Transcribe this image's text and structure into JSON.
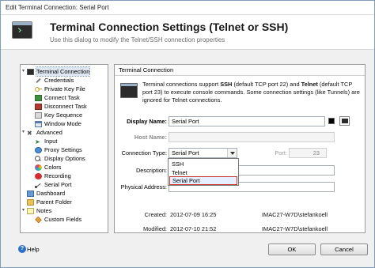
{
  "window": {
    "title": "Edit Terminal Connection: Serial Port"
  },
  "header": {
    "title": "Terminal Connection Settings (Telnet or SSH)",
    "subtitle": "Use this dialog to modify the Telnet/SSH connection properties"
  },
  "tree": {
    "items": [
      {
        "label": "Terminal Connection",
        "icon": "terminal-icon",
        "level": 0,
        "expanded": true,
        "selected": true
      },
      {
        "label": "Credentials",
        "icon": "wrench-icon",
        "level": 1
      },
      {
        "label": "Private Key File",
        "icon": "key-icon",
        "level": 1
      },
      {
        "label": "Connect Task",
        "icon": "connect-task-icon",
        "level": 1
      },
      {
        "label": "Disconnect Task",
        "icon": "disconnect-task-icon",
        "level": 1
      },
      {
        "label": "Key Sequence",
        "icon": "key-sequence-icon",
        "level": 1
      },
      {
        "label": "Window Mode",
        "icon": "window-icon",
        "level": 1
      },
      {
        "label": "Advanced",
        "icon": "tools-icon",
        "level": 0,
        "expanded": true
      },
      {
        "label": "Input",
        "icon": "input-icon",
        "level": 1
      },
      {
        "label": "Proxy Settings",
        "icon": "globe-icon",
        "level": 1
      },
      {
        "label": "Display Options",
        "icon": "search-icon",
        "level": 1
      },
      {
        "label": "Colors",
        "icon": "colors-icon",
        "level": 1
      },
      {
        "label": "Recording",
        "icon": "record-icon",
        "level": 1
      },
      {
        "label": "Serial Port",
        "icon": "serial-port-icon",
        "level": 1
      },
      {
        "label": "Dashboard",
        "icon": "dashboard-icon",
        "level": 0
      },
      {
        "label": "Parent Folder",
        "icon": "folder-icon",
        "level": 0
      },
      {
        "label": "Notes",
        "icon": "notes-icon",
        "level": 0,
        "expanded": true
      },
      {
        "label": "Custom Fields",
        "icon": "custom-fields-icon",
        "level": 1
      }
    ]
  },
  "panel": {
    "title": "Terminal Connection",
    "desc_pre": "Terminal connections support ",
    "desc_ssh": "SSH",
    "desc_mid": " (default TCP port 22) and ",
    "desc_telnet": "Telnet",
    "desc_post": " (default TCP port 23) to execute console commands. Some connection settings (like Tunnels) are ignored for Telnet connections."
  },
  "form": {
    "display_name_label": "Display Name:",
    "display_name_value": "Serial Port",
    "host_name_label": "Host Name:",
    "host_name_value": "",
    "connection_type_label": "Connection Type:",
    "connection_type_value": "Serial Port",
    "port_label": "Port:",
    "port_value": "23",
    "description_label": "Description:",
    "description_value": "",
    "physical_address_label": "Physical Address:",
    "physical_address_value": ""
  },
  "dropdown": {
    "options": [
      "SSH",
      "Telnet",
      "Serial Port"
    ],
    "highlighted": 2
  },
  "meta": {
    "created_label": "Created:",
    "created_date": "2012-07-09 16:25",
    "created_by": "IMAC27-W7D\\stefankoell",
    "modified_label": "Modified:",
    "modified_date": "2012-07-10 21:52",
    "modified_by": "IMAC27-W7D\\stefankoell"
  },
  "footer": {
    "help_label": "Help",
    "ok_label": "OK",
    "cancel_label": "Cancel"
  },
  "colors": {
    "highlight_border": "#c5342b",
    "selection_bg": "#dde6f1"
  }
}
